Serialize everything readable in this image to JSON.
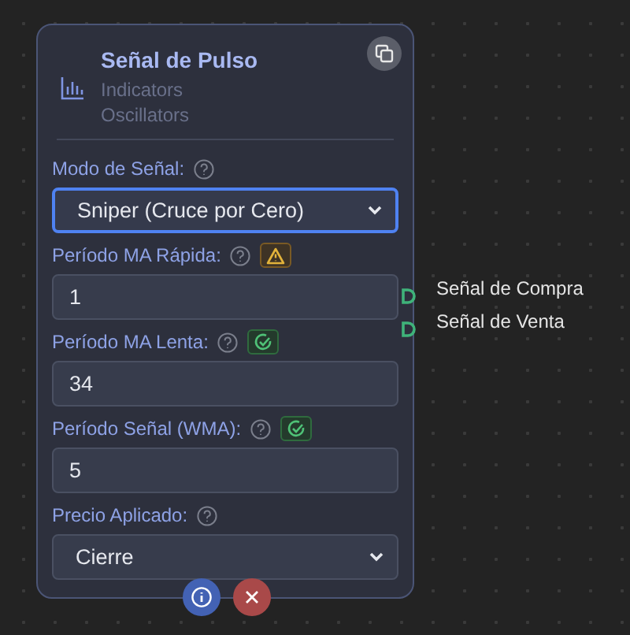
{
  "node": {
    "title": "Señal de Pulso",
    "categories": [
      "Indicators",
      "Oscillators"
    ],
    "fields": [
      {
        "kind": "select",
        "label": "Modo de Señal:",
        "value": "Sniper (Cruce por Cero)",
        "focused": true,
        "warning": false,
        "valid": false
      },
      {
        "kind": "number",
        "label": "Período MA Rápida:",
        "value": "1",
        "focused": false,
        "warning": true,
        "valid": false
      },
      {
        "kind": "number",
        "label": "Período MA Lenta:",
        "value": "34",
        "focused": false,
        "warning": false,
        "valid": true
      },
      {
        "kind": "number",
        "label": "Período Señal (WMA):",
        "value": "5",
        "focused": false,
        "warning": false,
        "valid": true
      },
      {
        "kind": "select",
        "label": "Precio Aplicado:",
        "value": "Cierre",
        "focused": false,
        "warning": false,
        "valid": false
      }
    ],
    "outputs": [
      "Señal de Compra",
      "Señal de Venta"
    ]
  }
}
